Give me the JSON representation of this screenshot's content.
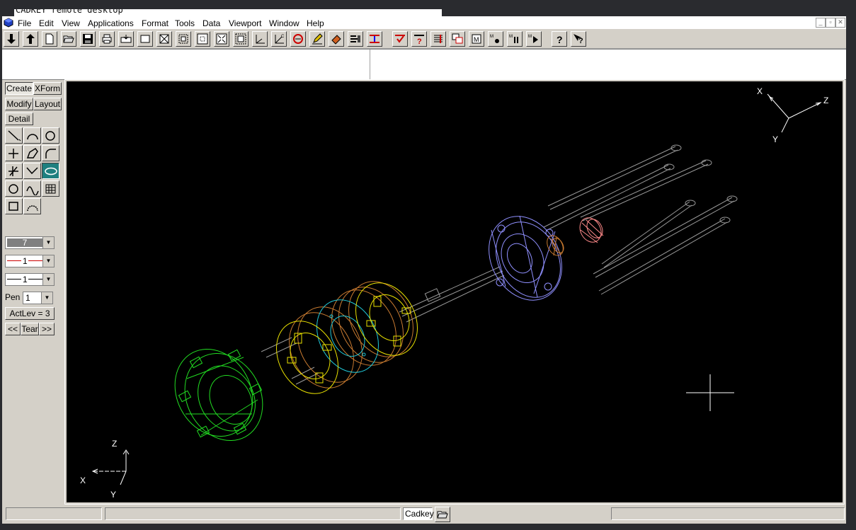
{
  "window": {
    "title": "CADKEY remote desktop"
  },
  "menu": [
    "File",
    "Edit",
    "View",
    "Applications",
    "Format",
    "Tools",
    "Data",
    "Viewport",
    "Window",
    "Help"
  ],
  "panel": {
    "create": "Create",
    "xform": "XForm",
    "modify": "Modify",
    "layout": "Layout",
    "detail": "Detail",
    "color_value": "7",
    "line_type_value": "1",
    "line_width_value": "1",
    "pen_label": "Pen",
    "pen_value": "1",
    "actlev": "ActLev = 3",
    "prev": "<<",
    "tear": "Tear",
    "next": ">>"
  },
  "axes": {
    "top_x": "X",
    "top_y": "Y",
    "top_z": "Z",
    "bottom_x": "X",
    "bottom_y": "Y",
    "bottom_z": "Z"
  },
  "status": {
    "app_name": "Cadkey"
  },
  "colors": {
    "green_part": "#22dd22",
    "yellow_part": "#e8e000",
    "orange_part": "#c87a30",
    "cyan_part": "#20c8d8",
    "lavender_part": "#9090ff",
    "salmon_part": "#ff8a8a",
    "rods": "#9a9a9a"
  }
}
